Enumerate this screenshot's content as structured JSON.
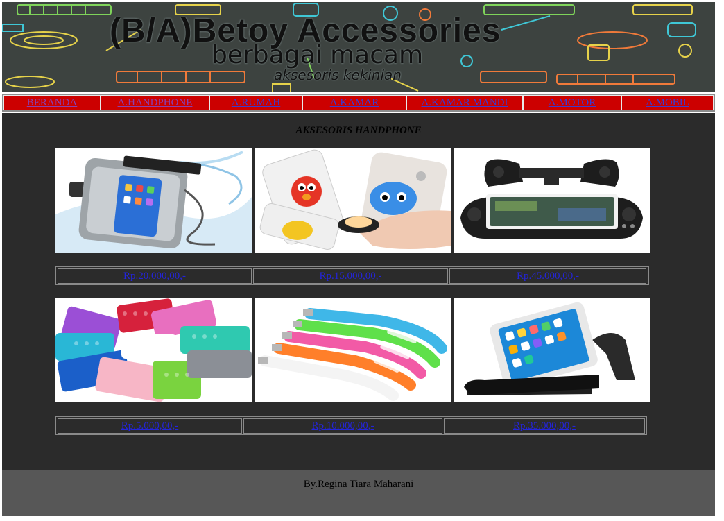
{
  "header": {
    "logo_main": "(B/A)Betoy Accessories",
    "logo_sub": "berbagai macam",
    "logo_sub2": "aksesoris kekinian"
  },
  "nav": {
    "items": [
      {
        "label": "BERANDA",
        "visited": true
      },
      {
        "label": "A.HANDPHONE",
        "visited": true
      },
      {
        "label": "A.RUMAH",
        "visited": false
      },
      {
        "label": "A.KAMAR",
        "visited": false
      },
      {
        "label": "A.KAMAR MANDI",
        "visited": false
      },
      {
        "label": "A.MOTOR",
        "visited": false
      },
      {
        "label": "A.MOBIL",
        "visited": false
      }
    ]
  },
  "main": {
    "title": "AKSESORIS HANDPHONE",
    "products": [
      {
        "image_icon": "waterproof-phone-pouch-image",
        "price": "Rp.20.000,00,-"
      },
      {
        "image_icon": "pop-socket-holder-image",
        "price": "Rp.15.000,00,-"
      },
      {
        "image_icon": "game-controller-image",
        "price": "Rp.45.000,00,-"
      },
      {
        "image_icon": "suction-pad-image",
        "price": "Rp.5.000,00,-"
      },
      {
        "image_icon": "usb-led-light-image",
        "price": "Rp.10.000,00,-"
      },
      {
        "image_icon": "phone-stand-image",
        "price": "Rp.35.000,00,-"
      }
    ]
  },
  "footer": {
    "credit": "By.Regina Tiara Maharani"
  },
  "colors": {
    "nav_bg": "#cc0000",
    "main_bg": "#2b2b2b",
    "footer_bg": "#575757",
    "link": "#2424d8",
    "visited_link": "#8a3fb0"
  }
}
